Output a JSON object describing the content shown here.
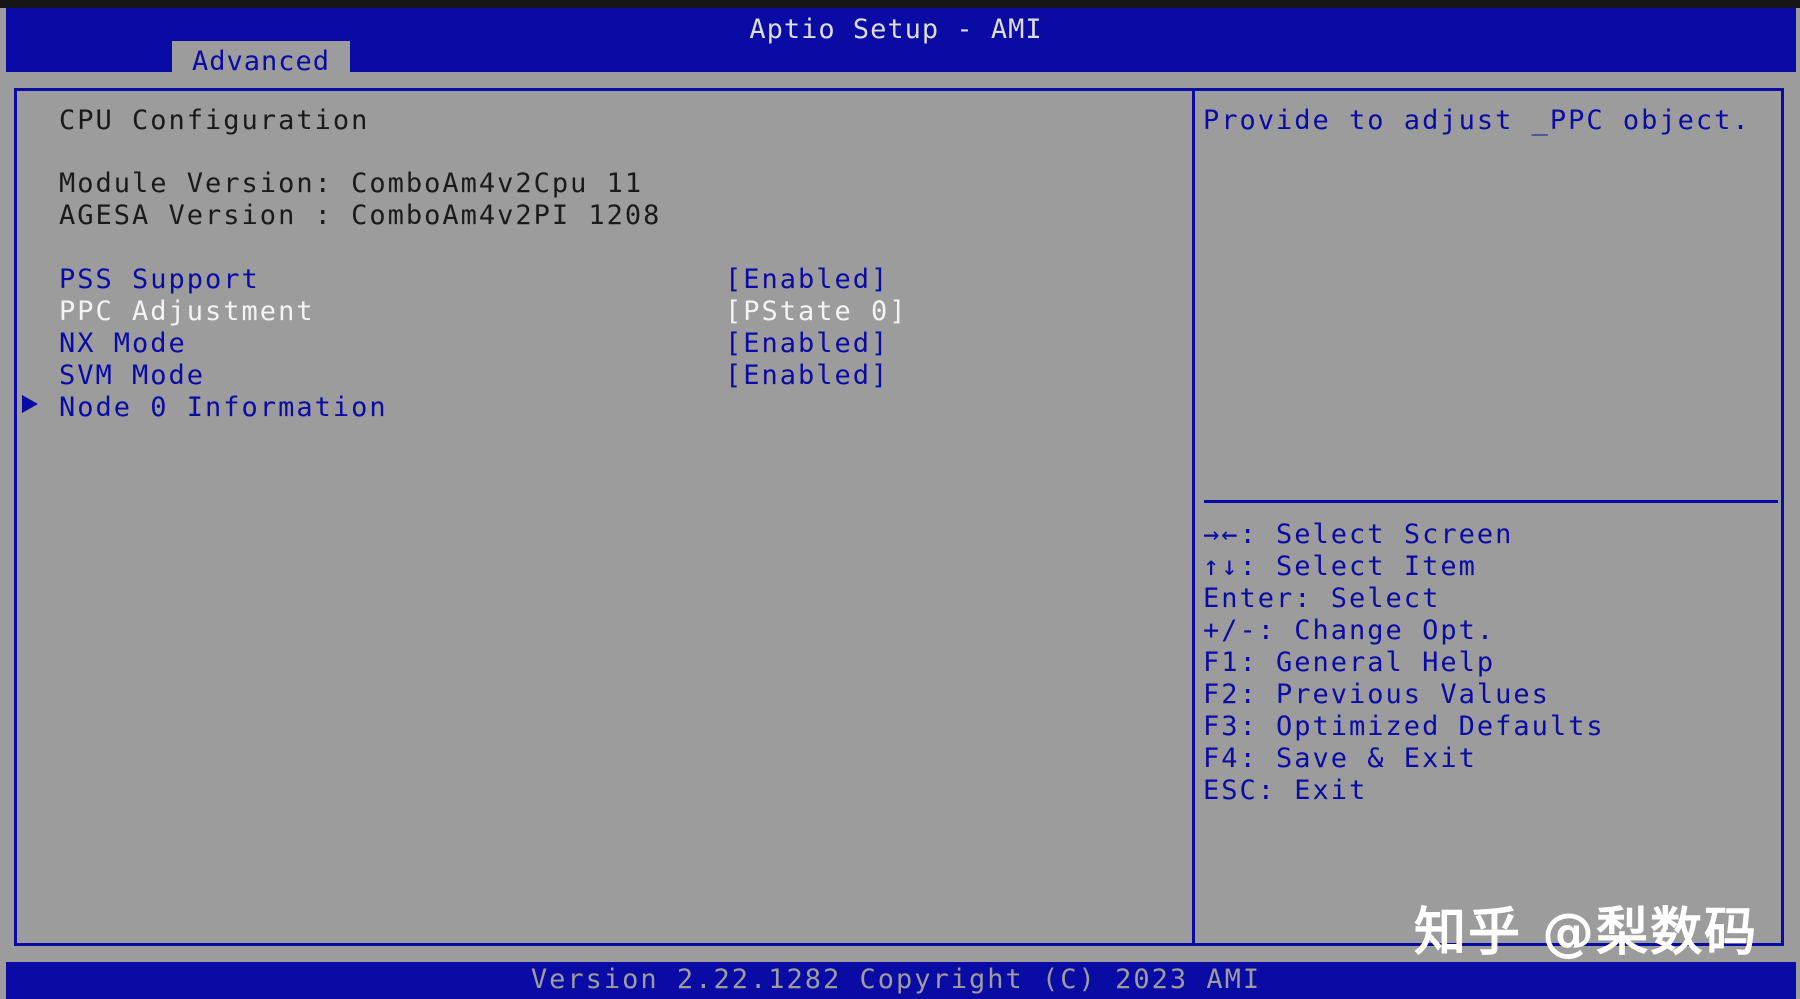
{
  "header": {
    "title": "Aptio Setup - AMI",
    "tab": "Advanced"
  },
  "main": {
    "section_title": "CPU Configuration",
    "module_version": "Module Version: ComboAm4v2Cpu 11",
    "agesa_version": "AGESA Version : ComboAm4v2PI 1208",
    "settings": [
      {
        "label": "PSS Support",
        "value": "[Enabled]"
      },
      {
        "label": "PPC Adjustment",
        "value": "[PState 0]"
      },
      {
        "label": "NX Mode",
        "value": "[Enabled]"
      },
      {
        "label": "SVM Mode",
        "value": "[Enabled]"
      }
    ],
    "submenu": "Node 0 Information"
  },
  "help": {
    "description": "Provide to adjust _PPC object.",
    "keys": [
      {
        "key": "→←",
        "text": ": Select Screen"
      },
      {
        "key": "↑↓",
        "text": ": Select Item"
      },
      {
        "key": "",
        "text": "Enter: Select"
      },
      {
        "key": "",
        "text": "+/-: Change Opt."
      },
      {
        "key": "",
        "text": "F1: General Help"
      },
      {
        "key": "",
        "text": "F2: Previous Values"
      },
      {
        "key": "",
        "text": "F3: Optimized Defaults"
      },
      {
        "key": "",
        "text": "F4: Save & Exit"
      },
      {
        "key": "",
        "text": "ESC: Exit"
      }
    ]
  },
  "footer": {
    "text": "Version 2.22.1282 Copyright (C) 2023 AMI"
  },
  "watermark": "知乎 @梨数码",
  "colors": {
    "bios_blue": "#0a0aa4",
    "panel_gray": "#9c9c9c",
    "highlight_white": "#f4f4f4"
  }
}
